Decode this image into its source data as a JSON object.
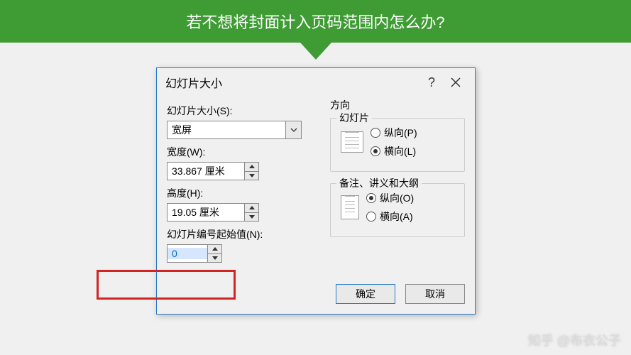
{
  "banner": {
    "text": "若不想将封面计入页码范围内怎么办?"
  },
  "dialog": {
    "title": "幻灯片大小",
    "help_label": "?",
    "left": {
      "size_label": "幻灯片大小(S):",
      "size_value": "宽屏",
      "width_label": "宽度(W):",
      "width_value": "33.867 厘米",
      "height_label": "高度(H):",
      "height_value": "19.05 厘米",
      "start_label": "幻灯片编号起始值(N):",
      "start_value": "0"
    },
    "right": {
      "direction_label": "方向",
      "slides_group": "幻灯片",
      "portrait_label": "纵向(P)",
      "landscape_label": "横向(L)",
      "notes_group": "备注、讲义和大纲",
      "notes_portrait_label": "纵向(O)",
      "notes_landscape_label": "横向(A)"
    },
    "buttons": {
      "ok": "确定",
      "cancel": "取消"
    }
  },
  "watermark": "知乎 @布衣公子"
}
